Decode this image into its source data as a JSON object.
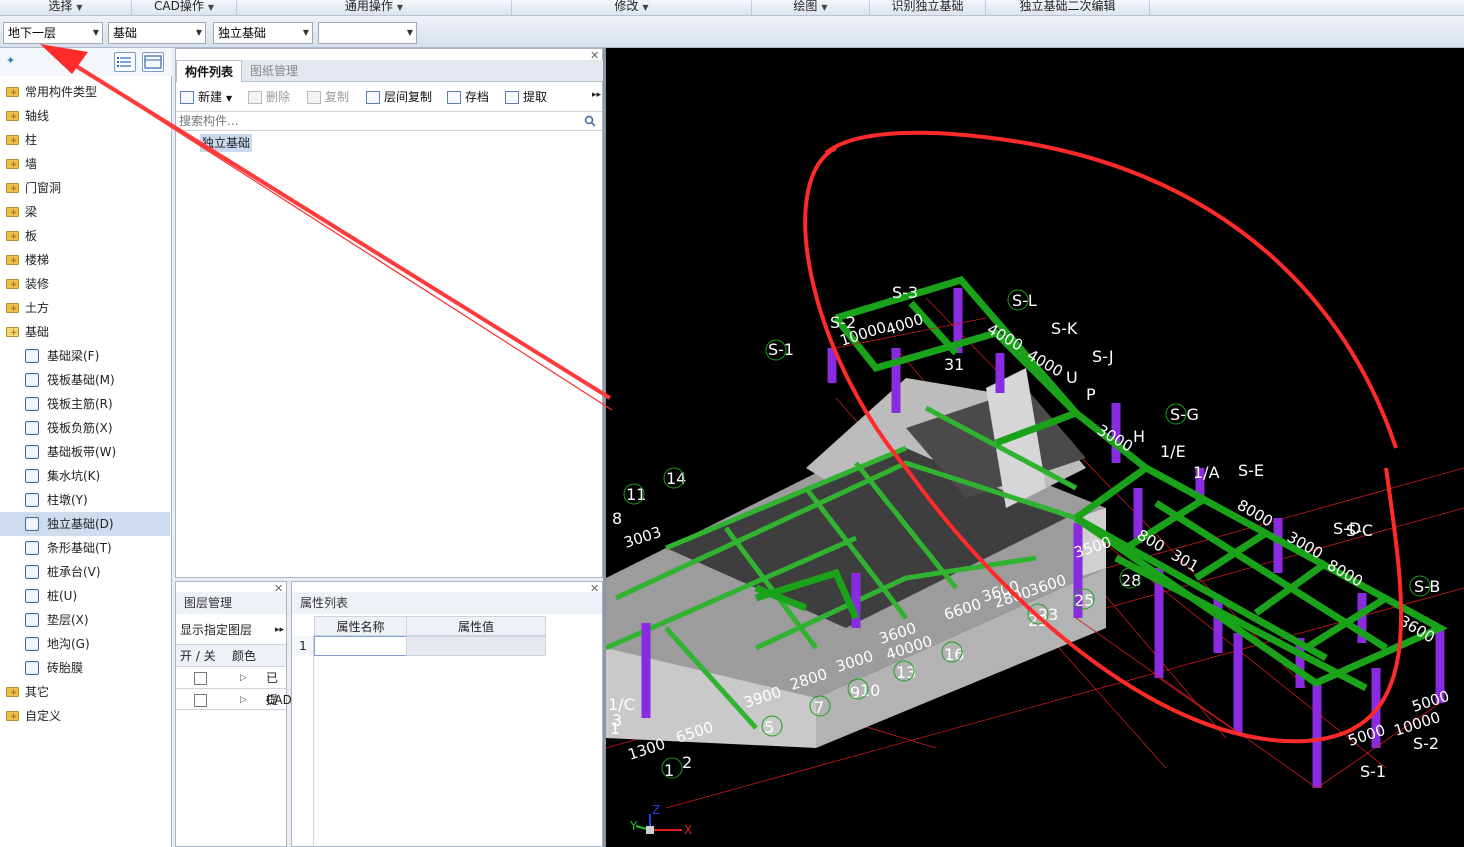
{
  "menu": [
    {
      "label": "选择",
      "dropdown": true
    },
    {
      "label": "CAD操作",
      "dropdown": true
    },
    {
      "label": "通用操作",
      "dropdown": true
    },
    {
      "label": "修改",
      "dropdown": true
    },
    {
      "label": "绘图",
      "dropdown": true
    },
    {
      "label": "识别独立基础",
      "dropdown": false
    },
    {
      "label": "独立基础二次编辑",
      "dropdown": false
    }
  ],
  "toolbar": {
    "floor_combo": "地下一层",
    "type_combo": "基础",
    "subtype_combo": "独立基础",
    "item_combo": ""
  },
  "tree": {
    "categories": [
      {
        "label": "常用构件类型"
      },
      {
        "label": "轴线"
      },
      {
        "label": "柱"
      },
      {
        "label": "墙"
      },
      {
        "label": "门窗洞"
      },
      {
        "label": "梁"
      },
      {
        "label": "板"
      },
      {
        "label": "楼梯"
      },
      {
        "label": "装修"
      },
      {
        "label": "土方"
      },
      {
        "label": "基础"
      }
    ],
    "foundation_items": [
      {
        "label": "基础梁(F)"
      },
      {
        "label": "筏板基础(M)"
      },
      {
        "label": "筏板主筋(R)"
      },
      {
        "label": "筏板负筋(X)"
      },
      {
        "label": "基础板带(W)"
      },
      {
        "label": "集水坑(K)"
      },
      {
        "label": "柱墩(Y)"
      },
      {
        "label": "独立基础(D)"
      },
      {
        "label": "条形基础(T)"
      },
      {
        "label": "桩承台(V)"
      },
      {
        "label": "桩(U)"
      },
      {
        "label": "垫层(X)"
      },
      {
        "label": "地沟(G)"
      },
      {
        "label": "砖胎膜"
      }
    ],
    "tail_categories": [
      {
        "label": "其它"
      },
      {
        "label": "自定义"
      }
    ]
  },
  "component_panel": {
    "tabs": [
      "构件列表",
      "图纸管理"
    ],
    "buttons": [
      {
        "label": "新建",
        "enabled": true
      },
      {
        "label": "删除",
        "enabled": false
      },
      {
        "label": "复制",
        "enabled": false
      },
      {
        "label": "层间复制",
        "enabled": true
      },
      {
        "label": "存档",
        "enabled": true
      },
      {
        "label": "提取",
        "enabled": true
      }
    ],
    "search_placeholder": "搜索构件...",
    "items": [
      "独立基础"
    ]
  },
  "layer_panel": {
    "title": "图层管理",
    "show_specified": "显示指定图层",
    "col_onoff": "开 / 关",
    "col_color": "颜色",
    "rows": [
      "已提",
      "CAD"
    ]
  },
  "property_panel": {
    "title": "属性列表",
    "col_name": "属性名称",
    "col_value": "属性值",
    "row_num": "1"
  },
  "viewport": {
    "axis_labels": [
      "S-3",
      "S-2",
      "S-1",
      "S-L",
      "S-K",
      "S-J",
      "S-G",
      "S-E",
      "S-D",
      "S-C",
      "S-B",
      "S-2",
      "S-1",
      "U",
      "P",
      "H",
      "1/E",
      "1/A",
      "31",
      "14",
      "11",
      "8",
      "28",
      "25",
      "22",
      "23",
      "16",
      "13",
      "10",
      "9",
      "7",
      "5",
      "2",
      "1",
      "1",
      "3",
      "1/C"
    ],
    "dimension_labels": [
      "10000",
      "4000",
      "4000",
      "4000",
      "3000",
      "3003",
      "6600",
      "3600",
      "40000",
      "3600",
      "3900",
      "2800",
      "3000",
      "6500",
      "1300",
      "3600",
      "3500",
      "800",
      "2800",
      "5000",
      "10000",
      "5000",
      "8000",
      "3000",
      "8000",
      "3600",
      "301"
    ],
    "axis_x": "X",
    "axis_y": "Y",
    "axis_z": "Z"
  }
}
